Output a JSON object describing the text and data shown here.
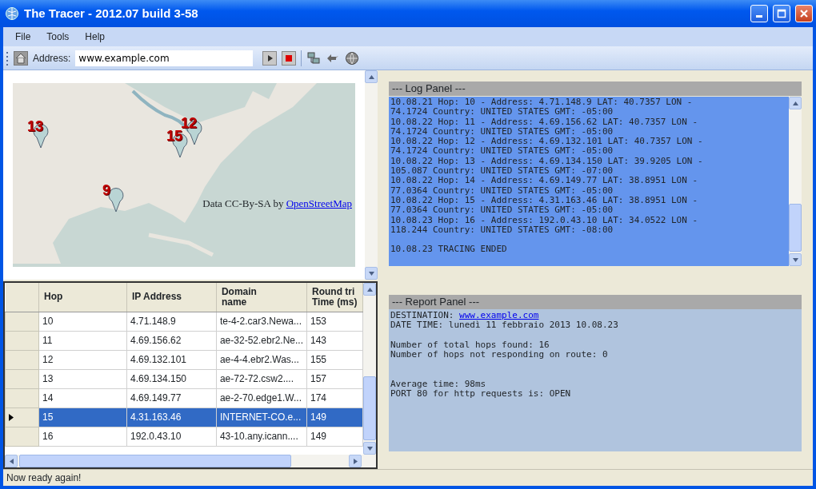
{
  "window": {
    "title": "The Tracer - 2012.07 build 3-58"
  },
  "menu": [
    "File",
    "Tools",
    "Help"
  ],
  "toolbar": {
    "address_label": "Address:",
    "address_value": "www.example.com"
  },
  "map": {
    "markers": [
      {
        "label": "13"
      },
      {
        "label": "12"
      },
      {
        "label": "15"
      },
      {
        "label": "9"
      }
    ],
    "attribution": "Data CC-By-SA by",
    "attribution_link": "OpenStreetMap"
  },
  "table": {
    "columns": [
      "Hop",
      "IP Address",
      "Domain\nname",
      "Round tri\nTime (ms)"
    ],
    "rows": [
      {
        "cells": [
          "10",
          "4.71.148.9",
          "te-4-2.car3.Newa...",
          "153"
        ],
        "selected": false
      },
      {
        "cells": [
          "11",
          "4.69.156.62",
          "ae-32-52.ebr2.Ne...",
          "143"
        ],
        "selected": false
      },
      {
        "cells": [
          "12",
          "4.69.132.101",
          "ae-4-4.ebr2.Was...",
          "155"
        ],
        "selected": false
      },
      {
        "cells": [
          "13",
          "4.69.134.150",
          "ae-72-72.csw2....",
          "157"
        ],
        "selected": false
      },
      {
        "cells": [
          "14",
          "4.69.149.77",
          "ae-2-70.edge1.W...",
          "174"
        ],
        "selected": false
      },
      {
        "cells": [
          "15",
          "4.31.163.46",
          "INTERNET-CO.e...",
          "149"
        ],
        "selected": true
      },
      {
        "cells": [
          "16",
          "192.0.43.10",
          "43-10.any.icann....",
          "149"
        ],
        "selected": false
      }
    ]
  },
  "log_panel": {
    "title": "--- Log Panel ---",
    "blocks": [
      [
        "10.08.21 Hop: 10 - Address: 4.71.148.9 LAT: 40.7357 LON -",
        "74.1724 Country: UNITED STATES GMT: -05:00",
        "10.08.22 Hop: 11 - Address: 4.69.156.62 LAT: 40.7357 LON -",
        "74.1724 Country: UNITED STATES GMT: -05:00",
        "10.08.22 Hop: 12 - Address: 4.69.132.101 LAT: 40.7357 LON -",
        "74.1724 Country: UNITED STATES GMT: -05:00",
        "10.08.22 Hop: 13 - Address: 4.69.134.150 LAT: 39.9205 LON -",
        "105.087 Country: UNITED STATES GMT: -07:00",
        "10.08.22 Hop: 14 - Address: 4.69.149.77 LAT: 38.8951 LON -",
        "77.0364 Country: UNITED STATES GMT: -05:00",
        "10.08.22 Hop: 15 - Address: 4.31.163.46 LAT: 38.8951 LON -",
        "77.0364 Country: UNITED STATES GMT: -05:00",
        "10.08.23 Hop: 16 - Address: 192.0.43.10 LAT: 34.0522 LON -",
        "118.244 Country: UNITED STATES GMT: -08:00"
      ],
      [
        "10.08.23 TRACING ENDED"
      ]
    ]
  },
  "report_panel": {
    "title": "--- Report Panel ---",
    "destination_label": "DESTINATION:",
    "destination_link": "www.example.com",
    "blocks": [
      {
        "lines": [
          "DATE TIME: lunedì 11 febbraio 2013 10.08.23"
        ]
      },
      {
        "lines": [
          "Number of total hops found: 16",
          "Number of hops not responding on route: 0"
        ]
      },
      {
        "lines": [
          "Average time: 98ms",
          "PORT 80 for http requests is: OPEN"
        ],
        "extra_space_before": true
      }
    ]
  },
  "status_bar": "Now ready again!"
}
